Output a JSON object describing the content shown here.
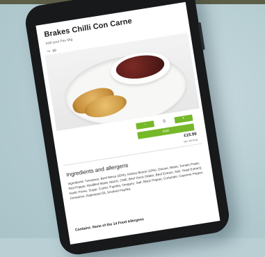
{
  "product": {
    "title": "Brakes Chilli Con Carne",
    "subtitle": "Add your Fav Mig",
    "share_count": "98",
    "price": "£15.99",
    "unit_note": "per serving",
    "add_label": "Add",
    "quantity": "0",
    "minus_label": "-",
    "plus_label": "+"
  },
  "icons": {
    "share": "share-icon"
  },
  "ingredients": {
    "heading": "Ingredients and allergens",
    "text": "Ingredients: Tomatoes, Beef Mince (20%), Kidney Beans (10%), Onions, Water, Tomato Paste, Red Pepper, Modified Maize Starch, Chilli, Beef Stock (Water, Beef Extract, Salt, Yeast Extract), Garlic Puree, Sugar, Cumin, Paprika, Oregano, Salt, Black Pepper, Coriander, Cayenne Pepper, Cinnamon, Rapeseed Oil, Smoked Paprika.",
    "allergen_note": "Contains: None of the 14 Food Allergens"
  },
  "colors": {
    "accent_green": "#76b82a",
    "background": "#b9cfd4",
    "phone_body": "#17191b"
  }
}
